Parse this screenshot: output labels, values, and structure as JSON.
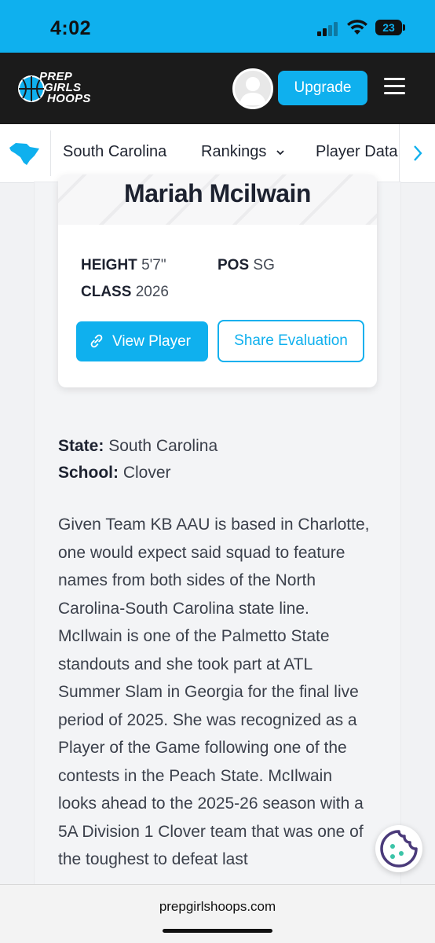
{
  "status_bar": {
    "time": "4:02",
    "battery": "23"
  },
  "header": {
    "logo_lines": [
      "PREP",
      "GIRLS",
      "HOOPS"
    ],
    "upgrade_label": "Upgrade"
  },
  "nav": {
    "items": [
      {
        "label": "South Carolina"
      },
      {
        "label": "Rankings"
      },
      {
        "label": "Player Data"
      }
    ]
  },
  "player": {
    "name": "Mariah Mcilwain",
    "height_label": "HEIGHT",
    "height_value": "5'7\"",
    "pos_label": "POS",
    "pos_value": "SG",
    "class_label": "CLASS",
    "class_value": "2026",
    "view_button": "View Player",
    "share_button": "Share Evaluation"
  },
  "details": {
    "state_label": "State:",
    "state_value": "South Carolina",
    "school_label": "School:",
    "school_value": "Clover"
  },
  "article": {
    "text": "Given Team KB AAU is based in Charlotte, one would expect said squad to feature names from both sides of the North Carolina-South Carolina state line. McIlwain is one of the Palmetto State standouts and she took part at ATL Summer Slam in Georgia for the final live period of 2025. She was recognized as a Player of the Game following one of the contests in the Peach State. McIlwain looks ahead to the 2025-26 season with a 5A Division 1 Clover team that was one of the toughest to defeat last"
  },
  "browser": {
    "url": "prepgirlshoops.com"
  },
  "colors": {
    "accent": "#0fb0ee",
    "header_bg": "#1b1b1b",
    "cookie_icon": "#4a3a7a"
  }
}
